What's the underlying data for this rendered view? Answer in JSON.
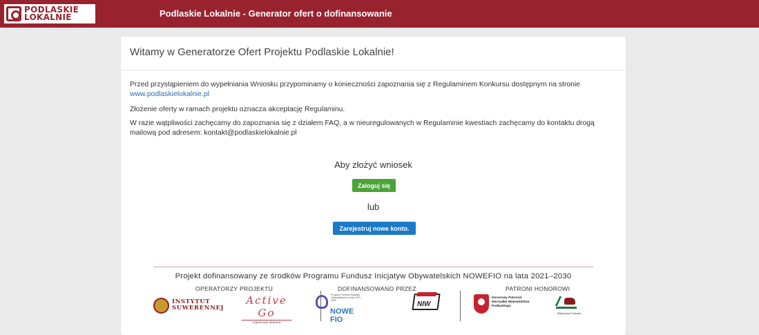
{
  "header": {
    "logo_line1": "PODLASKIE",
    "logo_line2": "LOKALNIE",
    "title": "Podlaskie Lokalnie - Generator ofert o dofinansowanie"
  },
  "main": {
    "welcome": "Witamy w Generatorze Ofert Projektu Podlaskie Lokalnie!",
    "intro_text": "Przed przystąpieniem do wypełniania Wniosku przypominamy o konieczności zapoznania się z Regulaminem Konkursu dostępnym na stronie",
    "intro_link": "www.podlaskielokalnie.pl",
    "acceptance": "Złożenie oferty w ramach projektu oznacza akceptację Regulaminu.",
    "contact_text": "W razie wątpliwości zachęcamy do zapoznania się z działem FAQ, a w nieuregulowanych w Regulaminie kwestiach zachęcamy do kontaktu drogą mailową pod adresem: kontakt@podlaskielokalnie.pl",
    "cta_heading": "Aby złożyć wniosek",
    "login_label": "Zaloguj się",
    "or_label": "lub",
    "register_label": "Zarejestruj nowe konto."
  },
  "footer": {
    "funded_text": "Projekt dofinansowany ze środków Programu Fundusz Inicjatyw Obywatelskich NOWEFIO na lata 2021–2030",
    "operators_title": "OPERATORZY PROJEKTU",
    "cofinanced_title": "DOFINANSOWANO PRZEZ",
    "patrons_title": "PATRONI HONOROWI",
    "inst_line1": "INSTYTUT",
    "inst_line2": "SUWERENNEJ",
    "active_go": "Active Go",
    "active_go_sub": "organizacja aktywna",
    "fio_small": "Program Fundusz Inicjatyw Obywatelskich na lata 2021–2030",
    "fio_big": "NOWE FIO",
    "niw": "NIW",
    "marszalek": "Honorowy Patronat Marszałka Województwa Podlaskiego",
    "wojewoda": "Wojewoda Podlaski"
  }
}
